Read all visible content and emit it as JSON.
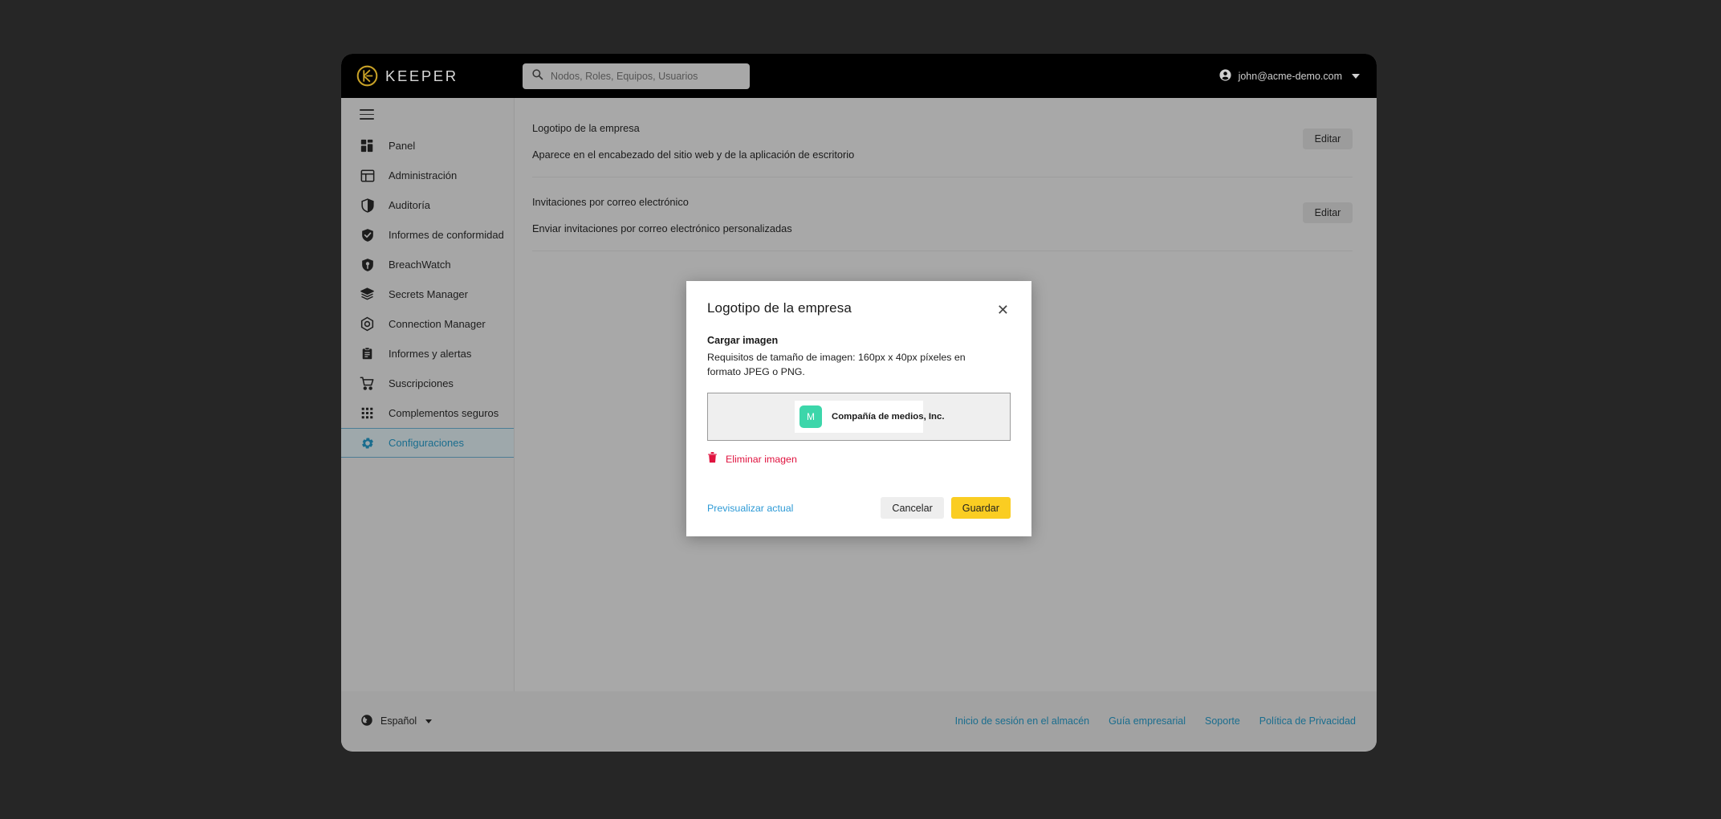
{
  "app": {
    "brand_name": "KEEPER",
    "logo_color": "#c9a227"
  },
  "topbar": {
    "search": {
      "placeholder": "Nodos, Roles, Equipos, Usuarios",
      "value": "",
      "icon": "search-icon"
    },
    "account": {
      "email": "john@acme-demo.com",
      "icon": "account-circle-icon",
      "caret": "chevron-down-icon"
    }
  },
  "sidebar": {
    "menu_toggle_icon": "hamburger-menu-icon",
    "active_color": "#1a6d8e",
    "items": [
      {
        "label": "Panel",
        "icon": "dashboard-icon",
        "active": false
      },
      {
        "label": "Administración",
        "icon": "admin-layout-icon",
        "active": false
      },
      {
        "label": "Auditoría",
        "icon": "shield-half-icon",
        "active": false
      },
      {
        "label": "Informes de conformidad",
        "icon": "shield-check-icon",
        "active": false
      },
      {
        "label": "BreachWatch",
        "icon": "shield-eye-icon",
        "active": false
      },
      {
        "label": "Secrets Manager",
        "icon": "layers-icon",
        "active": false
      },
      {
        "label": "Connection Manager",
        "icon": "hexagon-node-icon",
        "active": false
      },
      {
        "label": "Informes y alertas",
        "icon": "clipboard-icon",
        "active": false
      },
      {
        "label": "Suscripciones",
        "icon": "shopping-cart-icon",
        "active": false
      },
      {
        "label": "Complementos seguros",
        "icon": "grid-dots-icon",
        "active": false
      },
      {
        "label": "Configuraciones",
        "icon": "gear-icon",
        "active": true
      }
    ]
  },
  "main": {
    "settings": [
      {
        "title": "Logotipo de la empresa",
        "description": "Aparece en el encabezado del sitio web y de la aplicación de escritorio",
        "action_label": "Editar"
      },
      {
        "title": "Invitaciones por correo electrónico",
        "description": "Enviar invitaciones por correo electrónico personalizadas",
        "action_label": "Editar"
      }
    ]
  },
  "footer": {
    "language": {
      "label": "Español",
      "icon": "globe-icon",
      "caret": "chevron-down-icon"
    },
    "links": [
      {
        "label": "Inicio de sesión en el almacén"
      },
      {
        "label": "Guía empresarial"
      },
      {
        "label": "Soporte"
      },
      {
        "label": "Política de Privacidad"
      }
    ],
    "link_color": "#1a6d8e"
  },
  "modal": {
    "title": "Logotipo de la empresa",
    "close_icon": "close-icon",
    "upload_label": "Cargar imagen",
    "upload_requirements": "Requisitos de tamaño de imagen: 160px x 40px píxeles en formato JPEG o PNG.",
    "preview": {
      "swatch_letter": "M",
      "swatch_color": "#3cd6aa",
      "company_name": "Compañía de medios, Inc."
    },
    "remove": {
      "label": "Eliminar imagen",
      "icon": "trash-icon",
      "color": "#e0133f"
    },
    "preview_link_label": "Previsualizar actual",
    "cancel_label": "Cancelar",
    "save_label": "Guardar",
    "save_color": "#facd22"
  }
}
